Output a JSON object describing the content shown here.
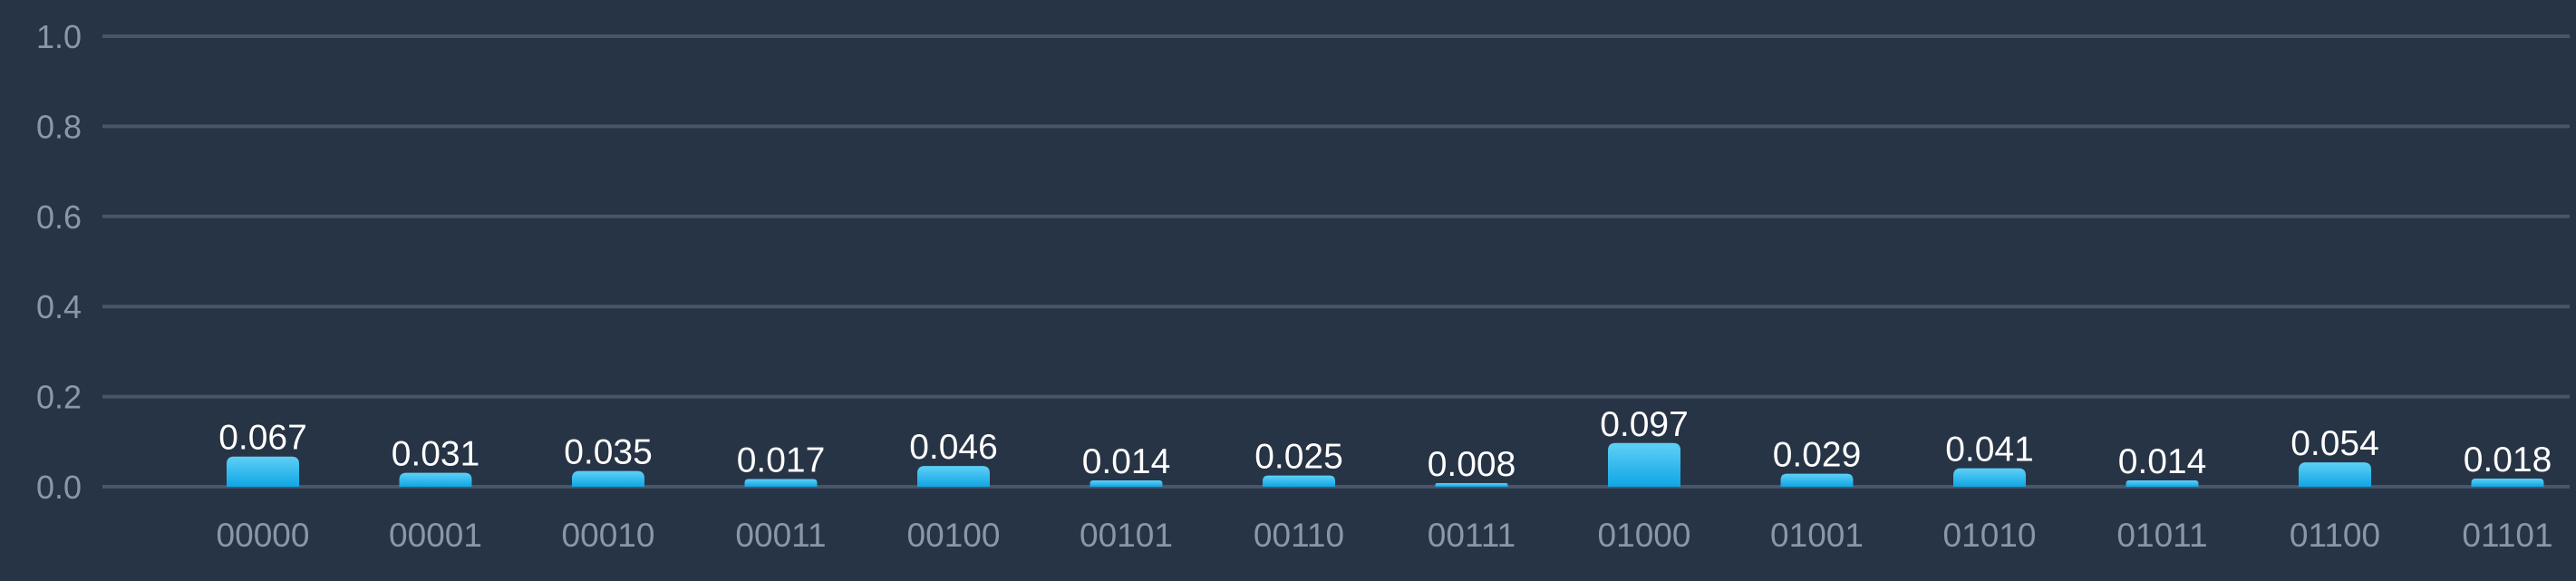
{
  "chart_data": {
    "type": "bar",
    "categories": [
      "00000",
      "00001",
      "00010",
      "00011",
      "00100",
      "00101",
      "00110",
      "00111",
      "01000",
      "01001",
      "01010",
      "01011",
      "01100",
      "01101"
    ],
    "values": [
      0.067,
      0.031,
      0.035,
      0.017,
      0.046,
      0.014,
      0.025,
      0.008,
      0.097,
      0.029,
      0.041,
      0.014,
      0.054,
      0.018
    ],
    "value_labels": [
      "0.067",
      "0.031",
      "0.035",
      "0.017",
      "0.046",
      "0.014",
      "0.025",
      "0.008",
      "0.097",
      "0.029",
      "0.041",
      "0.014",
      "0.054",
      "0.018"
    ],
    "ylim": [
      0,
      1.0
    ],
    "yticks": [
      "0.0",
      "0.2",
      "0.4",
      "0.6",
      "0.8",
      "1.0"
    ],
    "grid": true,
    "title": "",
    "xlabel": "",
    "ylabel": "",
    "colors": {
      "background": "#273445",
      "grid": "#48566a",
      "bar_top": "#5fd0f7",
      "bar_bottom": "#0fa6e4",
      "tick_text": "#8b97a8",
      "value_text": "#ffffff"
    }
  }
}
